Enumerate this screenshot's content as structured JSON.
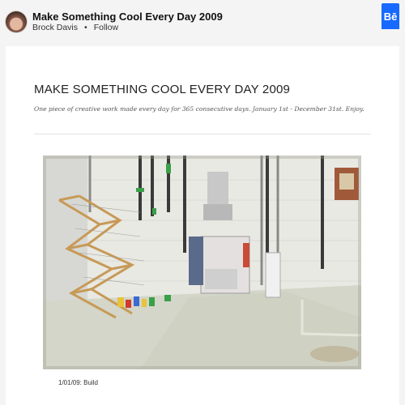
{
  "header": {
    "title": "Make Something Cool Every Day 2009",
    "author": "Brock Davis",
    "separator": "•",
    "follow_label": "Follow",
    "badge_label": "Bē",
    "brand_color": "#1769ff"
  },
  "project": {
    "heading": "MAKE SOMETHING COOL EVERY DAY 2009",
    "description": "One piece of creative work made every day for 365 consecutive days.  January 1st - December 31st. Enjoy.",
    "image_caption": "1/01/09: Build"
  },
  "icons": {
    "avatar": "avatar-photo",
    "badge": "behance-logo"
  }
}
